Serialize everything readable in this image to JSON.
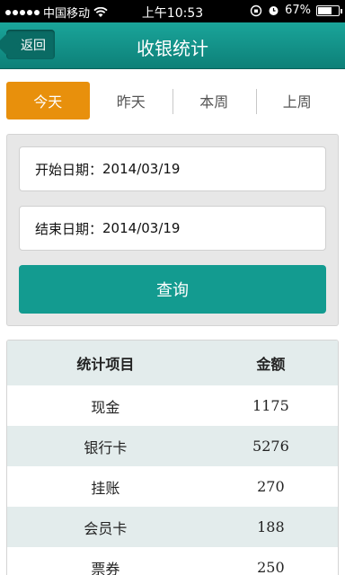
{
  "status_bar": {
    "carrier": "中国移动",
    "time": "上午10:53",
    "battery": "67%",
    "battery_level": 0.67
  },
  "nav": {
    "back_label": "返回",
    "title": "收银统计"
  },
  "tabs": [
    {
      "label": "今天",
      "active": true
    },
    {
      "label": "昨天",
      "active": false
    },
    {
      "label": "本周",
      "active": false
    },
    {
      "label": "上周",
      "active": false
    }
  ],
  "query": {
    "start_label": "开始日期：",
    "start_value": "2014/03/19",
    "end_label": "结束日期：",
    "end_value": "2014/03/19",
    "button_label": "查询"
  },
  "table": {
    "headers": [
      "统计项目",
      "金额"
    ],
    "rows": [
      {
        "item": "现金",
        "amount": "1175"
      },
      {
        "item": "银行卡",
        "amount": "5276"
      },
      {
        "item": "挂账",
        "amount": "270"
      },
      {
        "item": "会员卡",
        "amount": "188"
      },
      {
        "item": "票券",
        "amount": "250"
      }
    ]
  },
  "colors": {
    "accent": "#139b90",
    "active_tab": "#e8900c",
    "row_alt": "#e3ecec"
  }
}
